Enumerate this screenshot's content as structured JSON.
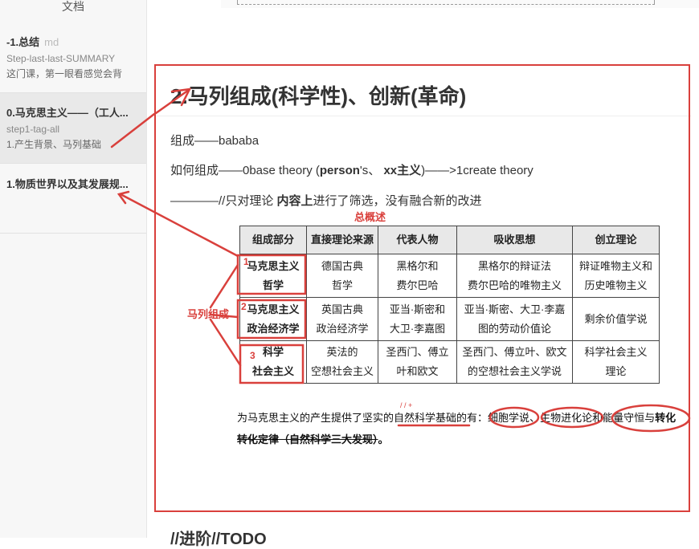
{
  "sidebar": {
    "header": "文档",
    "items": [
      {
        "title": "-1.总结",
        "ext": "md",
        "sub": "Step-last-last-SUMMARY",
        "preview": "这门课，第一眼看感觉会背"
      },
      {
        "title": "0.马克思主义——（工人...",
        "sub": "step1-tag-all",
        "preview": "1.产生背景、马列基础"
      },
      {
        "title": "1.物质世界以及其发展规..."
      }
    ]
  },
  "doc": {
    "heading": "2.马列组成(科学性)、创新(革命)",
    "p1": "组成——bababa",
    "p2_a": "如何组成——0base theory (",
    "p2_b": "person",
    "p2_c": "'s、 ",
    "p2_d": "xx主义",
    "p2_e": ")——>1create theory",
    "p3_a": "————//只对理论 ",
    "p3_b": "内容上",
    "p3_c": "进行了筛选，没有融合新的改进",
    "next_heading": "//进阶//TODO"
  },
  "annotations": {
    "overview": "总概述",
    "group": "马列组成",
    "n1": "1",
    "n2": "2",
    "n3": "3",
    "small_mark": "/ / +"
  },
  "table": {
    "headers": [
      "组成部分",
      "直接理论来源",
      "代表人物",
      "吸收思想",
      "创立理论"
    ],
    "rows": [
      [
        "马克思主义",
        "哲学",
        "德国古典",
        "哲学",
        "黑格尔和",
        "费尔巴哈",
        "黑格尔的辩证法",
        "费尔巴哈的唯物主义",
        "辩证唯物主义和",
        "历史唯物主义"
      ],
      [
        "马克思主义",
        "政治经济学",
        "英国古典",
        "政治经济学",
        "亚当·斯密和",
        "大卫·李嘉图",
        "亚当·斯密、大卫·李嘉",
        "图的劳动价值论",
        "剩余价值学说",
        ""
      ],
      [
        "科学",
        "社会主义",
        "英法的",
        "空想社会主义",
        "圣西门、傅立",
        "叶和欧文",
        "圣西门、傅立叶、欧文",
        "的空想社会主义学说",
        "科学社会主义",
        "理论"
      ]
    ]
  },
  "bottom": {
    "line1_a": "为马克思主义的产生提供了坚实的",
    "line1_b": "自然科学基础",
    "line1_c": "的有：",
    "line1_d": "细胞学说",
    "line1_e": "、生物进化论和能量守恒与",
    "line1_f": "转化",
    "line2_a": "转化定律（自然科学三大发现）",
    "line2_b": "。"
  },
  "colors": {
    "accent_red": "#d9403c"
  }
}
